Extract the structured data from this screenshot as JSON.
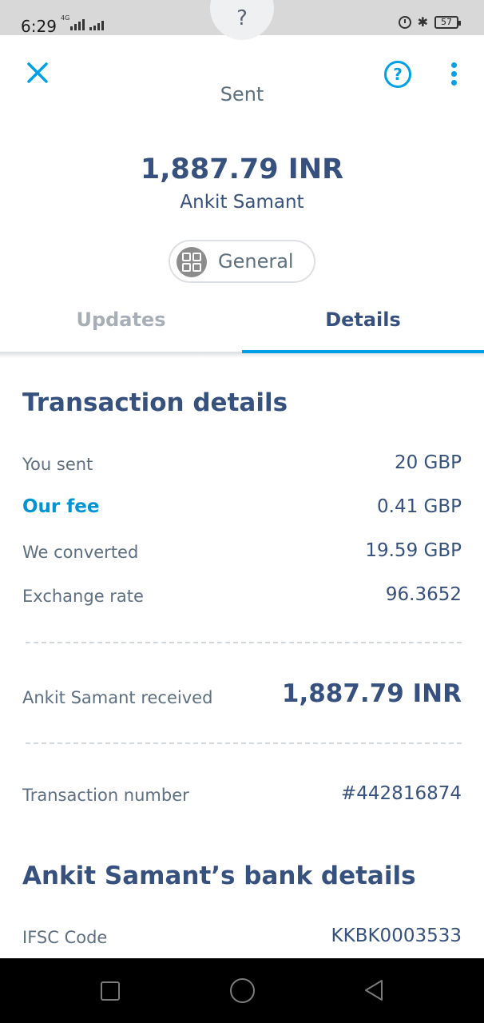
{
  "status_bar": {
    "time": "6:29",
    "network": "4G",
    "battery": "57",
    "icons": [
      "alarm-icon",
      "bluetooth-icon",
      "battery-icon"
    ]
  },
  "header": {
    "status_label": "Sent",
    "top_icon": "question-mark-icon",
    "close_icon": "close-icon",
    "help_icon": "help-icon",
    "more_icon": "more-vertical-icon",
    "accent_color": "#00a0e6"
  },
  "summary": {
    "amount": "1,887.79 INR",
    "recipient": "Ankit Samant",
    "category": "General"
  },
  "tabs": [
    {
      "label": "Updates",
      "active": false
    },
    {
      "label": "Details",
      "active": true
    }
  ],
  "transaction": {
    "title": "Transaction details",
    "rows": [
      {
        "label": "You sent",
        "value": "20 GBP"
      },
      {
        "label": "Our fee",
        "value": "0.41 GBP"
      },
      {
        "label": "We converted",
        "value": "19.59 GBP"
      },
      {
        "label": "Exchange rate",
        "value": "96.3652"
      }
    ],
    "received_label": "Ankit Samant received",
    "received_value": "1,887.79 INR",
    "number_label": "Transaction number",
    "number_value": "#442816874"
  },
  "bank": {
    "title": "Ankit Samant’s bank details",
    "rows": [
      {
        "label": "IFSC Code",
        "value": "KKBK0003533"
      }
    ]
  },
  "nav_bar": {
    "icons": [
      "recent-apps-icon",
      "home-icon",
      "back-icon"
    ]
  },
  "colors": {
    "primary_text": "#37517e",
    "secondary_text": "#5d6f80",
    "accent": "#00a0e6"
  }
}
